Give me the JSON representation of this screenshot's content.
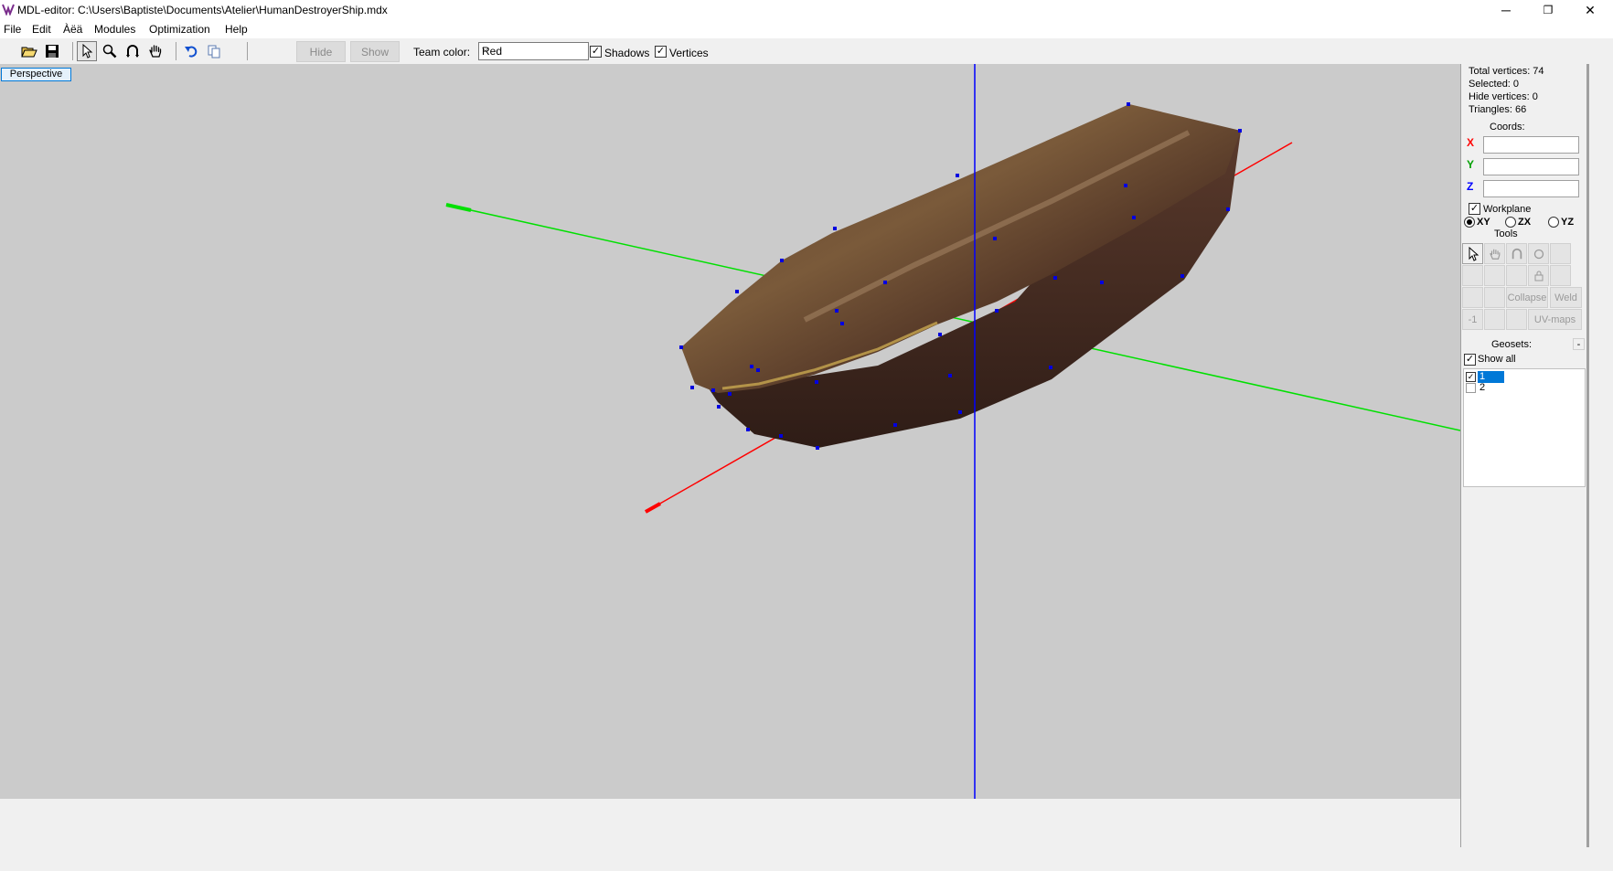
{
  "window": {
    "title": "MDL-editor: C:\\Users\\Baptiste\\Documents\\Atelier\\HumanDestroyerShip.mdx",
    "minimize": "─",
    "restore": "❐",
    "close": "✕"
  },
  "menu": [
    "File",
    "Edit",
    "Àëä",
    "Modules",
    "Optimization",
    "Help"
  ],
  "toolbar": {
    "hide_label": "Hide",
    "show_label": "Show",
    "team_color_label": "Team color:",
    "team_color_value": "Red",
    "shadows_label": "Shadows",
    "shadows_checked": true,
    "vertices_label": "Vertices",
    "vertices_checked": true,
    "icons": [
      "open-icon",
      "save-icon",
      "select-arrow-icon",
      "zoom-icon",
      "rotate-icon",
      "pan-hand-icon",
      "undo-icon",
      "copy-icon"
    ]
  },
  "viewport": {
    "mode_label": "Perspective",
    "background": "#cbcbcb",
    "axis_colors": {
      "x": "#ff0000",
      "y": "#00e000",
      "z": "#0000ff"
    },
    "vertex_color": "#0000e0"
  },
  "panel": {
    "total_vertices": "Total vertices: 74",
    "selected": "Selected: 0",
    "hide_vertices": "Hide vertices: 0",
    "triangles": "Triangles: 66",
    "coords_label": "Coords:",
    "x_label": "X",
    "y_label": "Y",
    "z_label": "Z",
    "x_value": "",
    "y_value": "",
    "z_value": "",
    "workplane_label": "Workplane",
    "plane_xy": "XY",
    "plane_zx": "ZX",
    "plane_yz": "YZ",
    "tools_label": "Tools",
    "collapse_label": "Collapse",
    "weld_label": "Weld",
    "minus_one_label": "-1",
    "uv_maps_label": "UV-maps",
    "geosets_label": "Geosets:",
    "geosets_collapse": "-",
    "show_all_label": "Show all",
    "geosets": [
      {
        "label": "1",
        "checked": true,
        "selected": true
      },
      {
        "label": "2",
        "checked": false,
        "selected": false
      }
    ]
  }
}
